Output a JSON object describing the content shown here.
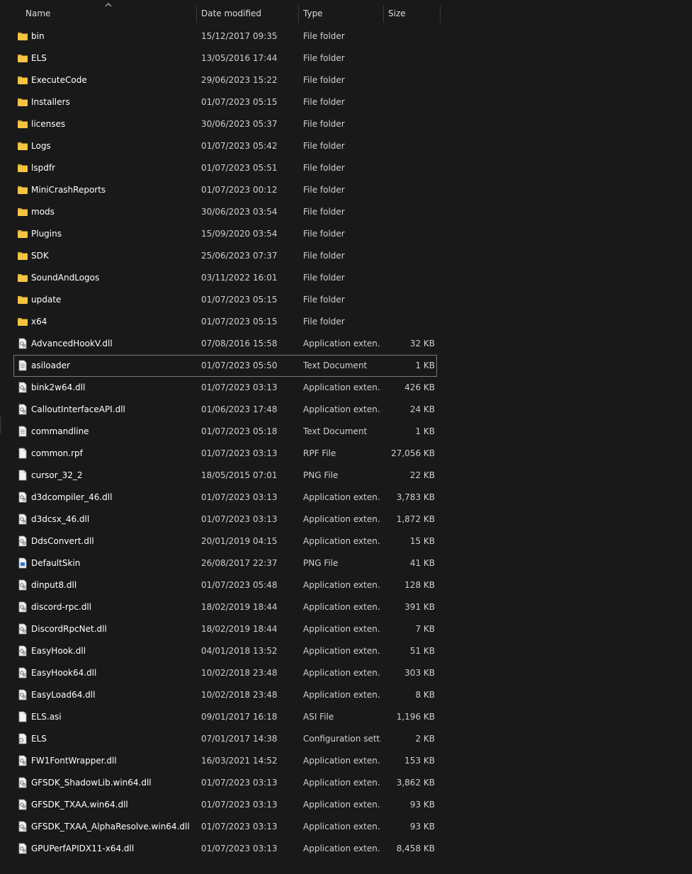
{
  "columns": {
    "name": "Name",
    "date": "Date modified",
    "type": "Type",
    "size": "Size"
  },
  "sort": {
    "column": "name",
    "direction": "ascending",
    "icon": "chevron-up-icon"
  },
  "files": [
    {
      "name": "bin",
      "date": "15/12/2017 09:35",
      "type": "File folder",
      "size": "",
      "icon": "folder-icon"
    },
    {
      "name": "ELS",
      "date": "13/05/2016 17:44",
      "type": "File folder",
      "size": "",
      "icon": "folder-icon"
    },
    {
      "name": "ExecuteCode",
      "date": "29/06/2023 15:22",
      "type": "File folder",
      "size": "",
      "icon": "folder-icon"
    },
    {
      "name": "Installers",
      "date": "01/07/2023 05:15",
      "type": "File folder",
      "size": "",
      "icon": "folder-icon"
    },
    {
      "name": "licenses",
      "date": "30/06/2023 05:37",
      "type": "File folder",
      "size": "",
      "icon": "folder-icon"
    },
    {
      "name": "Logs",
      "date": "01/07/2023 05:42",
      "type": "File folder",
      "size": "",
      "icon": "folder-icon"
    },
    {
      "name": "lspdfr",
      "date": "01/07/2023 05:51",
      "type": "File folder",
      "size": "",
      "icon": "folder-icon"
    },
    {
      "name": "MiniCrashReports",
      "date": "01/07/2023 00:12",
      "type": "File folder",
      "size": "",
      "icon": "folder-icon"
    },
    {
      "name": "mods",
      "date": "30/06/2023 03:54",
      "type": "File folder",
      "size": "",
      "icon": "folder-icon"
    },
    {
      "name": "Plugins",
      "date": "15/09/2020 03:54",
      "type": "File folder",
      "size": "",
      "icon": "folder-icon"
    },
    {
      "name": "SDK",
      "date": "25/06/2023 07:37",
      "type": "File folder",
      "size": "",
      "icon": "folder-icon"
    },
    {
      "name": "SoundAndLogos",
      "date": "03/11/2022 16:01",
      "type": "File folder",
      "size": "",
      "icon": "folder-icon"
    },
    {
      "name": "update",
      "date": "01/07/2023 05:15",
      "type": "File folder",
      "size": "",
      "icon": "folder-icon"
    },
    {
      "name": "x64",
      "date": "01/07/2023 05:15",
      "type": "File folder",
      "size": "",
      "icon": "folder-icon"
    },
    {
      "name": "AdvancedHookV.dll",
      "date": "07/08/2016 15:58",
      "type": "Application exten...",
      "size": "32 KB",
      "icon": "dll-file-icon"
    },
    {
      "name": "asiloader",
      "date": "01/07/2023 05:50",
      "type": "Text Document",
      "size": "1 KB",
      "icon": "text-file-icon",
      "selected": true
    },
    {
      "name": "bink2w64.dll",
      "date": "01/07/2023 03:13",
      "type": "Application exten...",
      "size": "426 KB",
      "icon": "dll-file-icon"
    },
    {
      "name": "CalloutInterfaceAPI.dll",
      "date": "01/06/2023 17:48",
      "type": "Application exten...",
      "size": "24 KB",
      "icon": "dll-file-icon"
    },
    {
      "name": "commandline",
      "date": "01/07/2023 05:18",
      "type": "Text Document",
      "size": "1 KB",
      "icon": "text-file-icon"
    },
    {
      "name": "common.rpf",
      "date": "01/07/2023 03:13",
      "type": "RPF File",
      "size": "27,056 KB",
      "icon": "blank-file-icon"
    },
    {
      "name": "cursor_32_2",
      "date": "18/05/2015 07:01",
      "type": "PNG File",
      "size": "22 KB",
      "icon": "blank-file-icon"
    },
    {
      "name": "d3dcompiler_46.dll",
      "date": "01/07/2023 03:13",
      "type": "Application exten...",
      "size": "3,783 KB",
      "icon": "dll-file-icon"
    },
    {
      "name": "d3dcsx_46.dll",
      "date": "01/07/2023 03:13",
      "type": "Application exten...",
      "size": "1,872 KB",
      "icon": "dll-file-icon"
    },
    {
      "name": "DdsConvert.dll",
      "date": "20/01/2019 04:15",
      "type": "Application exten...",
      "size": "15 KB",
      "icon": "dll-file-icon"
    },
    {
      "name": "DefaultSkin",
      "date": "26/08/2017 22:37",
      "type": "PNG File",
      "size": "41 KB",
      "icon": "image-file-icon"
    },
    {
      "name": "dinput8.dll",
      "date": "01/07/2023 05:48",
      "type": "Application exten...",
      "size": "128 KB",
      "icon": "dll-file-icon"
    },
    {
      "name": "discord-rpc.dll",
      "date": "18/02/2019 18:44",
      "type": "Application exten...",
      "size": "391 KB",
      "icon": "dll-file-icon"
    },
    {
      "name": "DiscordRpcNet.dll",
      "date": "18/02/2019 18:44",
      "type": "Application exten...",
      "size": "7 KB",
      "icon": "dll-file-icon"
    },
    {
      "name": "EasyHook.dll",
      "date": "04/01/2018 13:52",
      "type": "Application exten...",
      "size": "51 KB",
      "icon": "dll-file-icon"
    },
    {
      "name": "EasyHook64.dll",
      "date": "10/02/2018 23:48",
      "type": "Application exten...",
      "size": "303 KB",
      "icon": "dll-file-icon"
    },
    {
      "name": "EasyLoad64.dll",
      "date": "10/02/2018 23:48",
      "type": "Application exten...",
      "size": "8 KB",
      "icon": "dll-file-icon"
    },
    {
      "name": "ELS.asi",
      "date": "09/01/2017 16:18",
      "type": "ASI File",
      "size": "1,196 KB",
      "icon": "blank-file-icon"
    },
    {
      "name": "ELS",
      "date": "07/01/2017 14:38",
      "type": "Configuration sett...",
      "size": "2 KB",
      "icon": "config-file-icon"
    },
    {
      "name": "FW1FontWrapper.dll",
      "date": "16/03/2021 14:52",
      "type": "Application exten...",
      "size": "153 KB",
      "icon": "dll-file-icon"
    },
    {
      "name": "GFSDK_ShadowLib.win64.dll",
      "date": "01/07/2023 03:13",
      "type": "Application exten...",
      "size": "3,862 KB",
      "icon": "dll-file-icon"
    },
    {
      "name": "GFSDK_TXAA.win64.dll",
      "date": "01/07/2023 03:13",
      "type": "Application exten...",
      "size": "93 KB",
      "icon": "dll-file-icon"
    },
    {
      "name": "GFSDK_TXAA_AlphaResolve.win64.dll",
      "date": "01/07/2023 03:13",
      "type": "Application exten...",
      "size": "93 KB",
      "icon": "dll-file-icon"
    },
    {
      "name": "GPUPerfAPIDX11-x64.dll",
      "date": "01/07/2023 03:13",
      "type": "Application exten...",
      "size": "8,458 KB",
      "icon": "dll-file-icon"
    }
  ],
  "colors": {
    "background": "#191919",
    "text": "#ffffff",
    "muted_text": "#cfcfcf",
    "folder": "#f5c542",
    "selection_border": "#7a7a7a"
  }
}
